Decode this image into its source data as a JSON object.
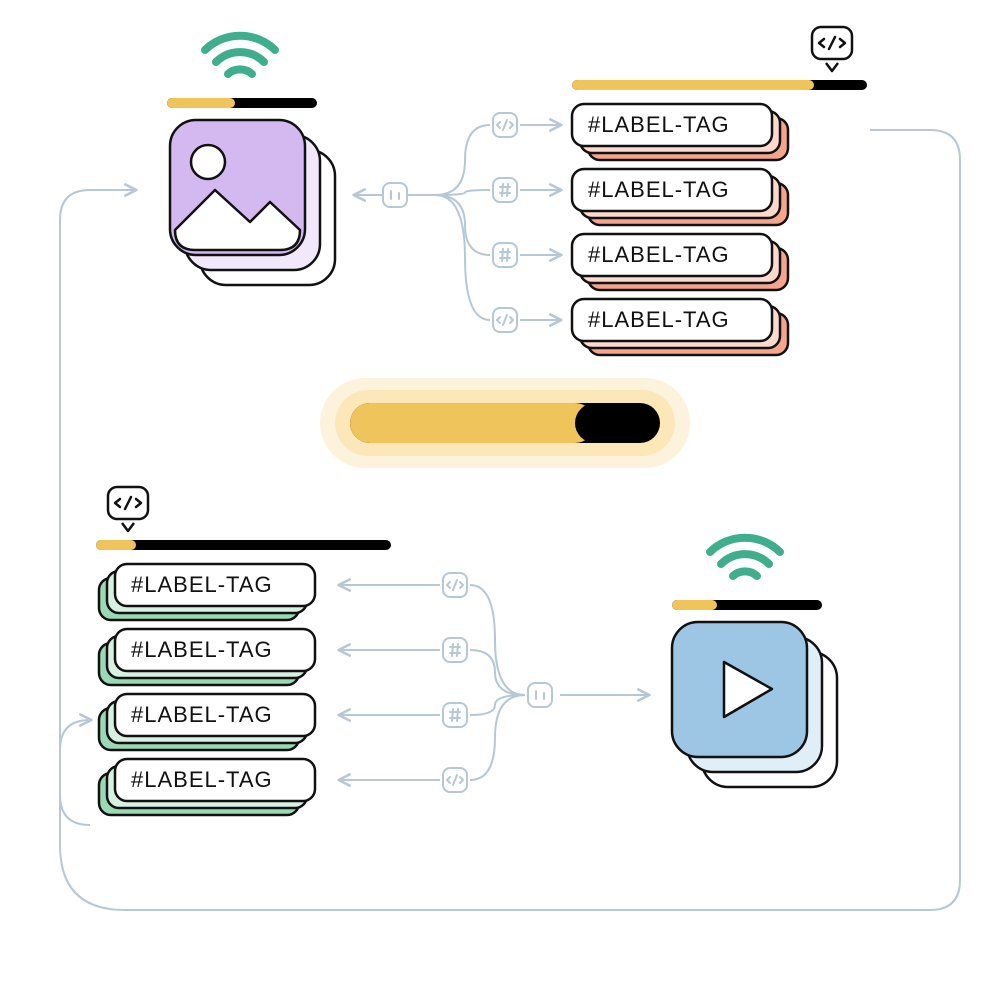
{
  "labels": {
    "top": [
      "#LABEL-TAG",
      "#LABEL-TAG",
      "#LABEL-TAG",
      "#LABEL-TAG"
    ],
    "bottom": [
      "#LABEL-TAG",
      "#LABEL-TAG",
      "#LABEL-TAG",
      "#LABEL-TAG"
    ]
  },
  "colors": {
    "yellow": "#EFC45B",
    "black": "#000000",
    "purple": "#D4B9F0",
    "blue": "#9CC6E3",
    "teal": "#3FAE8D",
    "red_shadow": "#F5A58E",
    "green_shadow": "#9BD9B4",
    "branch": "#B6C8D6",
    "glow1": "#FBE7B8",
    "glow2": "#FDF3DC"
  },
  "progress": {
    "image_node": 0.45,
    "top_labels": 0.82,
    "center": 0.65,
    "bottom_labels": 0.13,
    "video_node": 0.3
  }
}
